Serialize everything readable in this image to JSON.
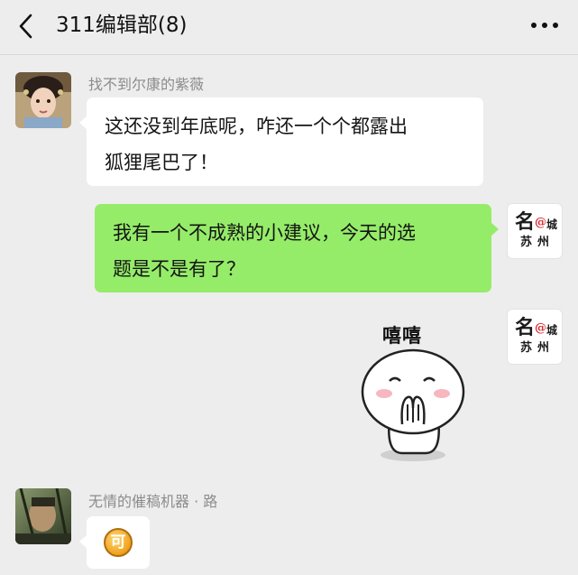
{
  "header": {
    "title": "311编辑部(8)"
  },
  "messages": {
    "m1": {
      "sender": "找不到尔康的紫薇",
      "line1": "这还没到年底呢，咋还一个个都露出",
      "line2": "狐狸尾巴了！"
    },
    "m2": {
      "line1": "我有一个不成熟的小建议，今天的选",
      "line2": "题是不是有了？"
    },
    "m3": {
      "sticker_text": "嘻嘻"
    },
    "m4": {
      "sender": "无情的催稿机器 · 路",
      "emoji_char": "可"
    }
  },
  "logo_avatar": {
    "top_char": "名",
    "at": "@",
    "small_char": "城",
    "bottom": "苏州"
  },
  "colors": {
    "background": "#ededed",
    "self_bubble": "#95ec69",
    "other_bubble": "#ffffff",
    "sender_name": "#8c8c8c"
  }
}
